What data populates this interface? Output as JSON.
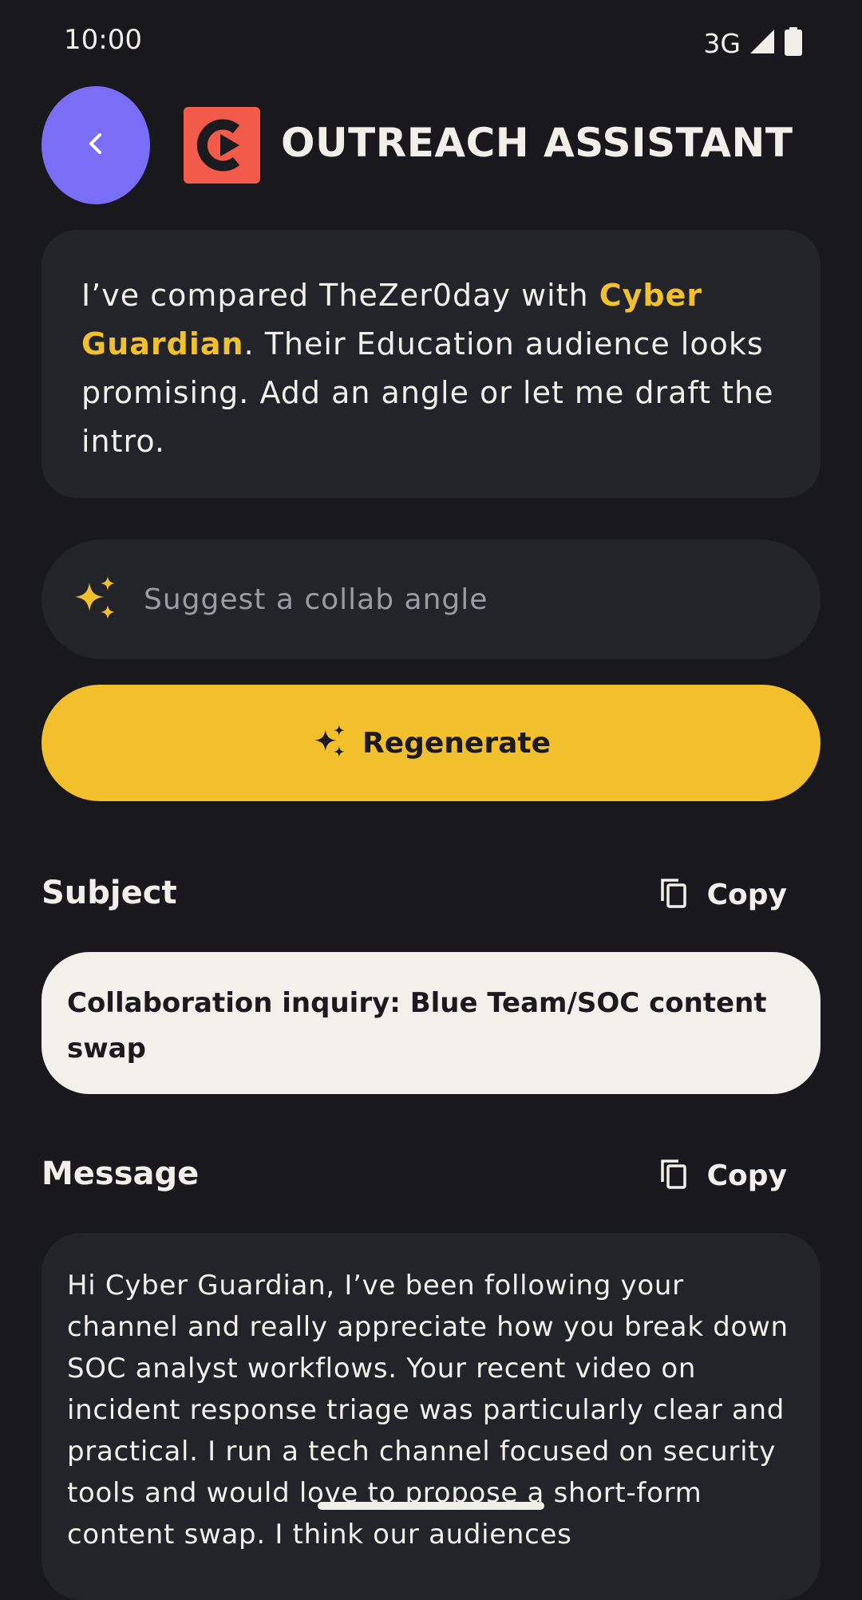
{
  "status_bar": {
    "time": "10:00",
    "network": "3G"
  },
  "header": {
    "title": "OUTREACH ASSISTANT"
  },
  "intro": {
    "part1": "I’ve compared TheZer0day with ",
    "channel_name": "Cyber Guardian",
    "part2": ". Their Education audience looks promising. Add an angle or let me draft the intro."
  },
  "angle_input": {
    "placeholder": "Suggest a collab angle",
    "value": ""
  },
  "regenerate": {
    "label": "Regenerate"
  },
  "subject": {
    "label": "Subject",
    "copy_label": "Copy",
    "value": "Collaboration inquiry: Blue Team/SOC content swap"
  },
  "message": {
    "label": "Message",
    "copy_label": "Copy",
    "body": "Hi Cyber Guardian, I’ve been following your channel and really appreciate how you break down SOC analyst workflows. Your recent video on incident response triage was particularly clear and practical. I run a tech channel focused on security tools and would love to propose a short-form content swap. I think our audiences"
  },
  "colors": {
    "background": "#18181d",
    "card": "#23232a",
    "accent_yellow": "#f3c02d",
    "back_button": "#7b6ef6",
    "logo": "#f25b4a",
    "subject_box": "#f2f0eb"
  }
}
